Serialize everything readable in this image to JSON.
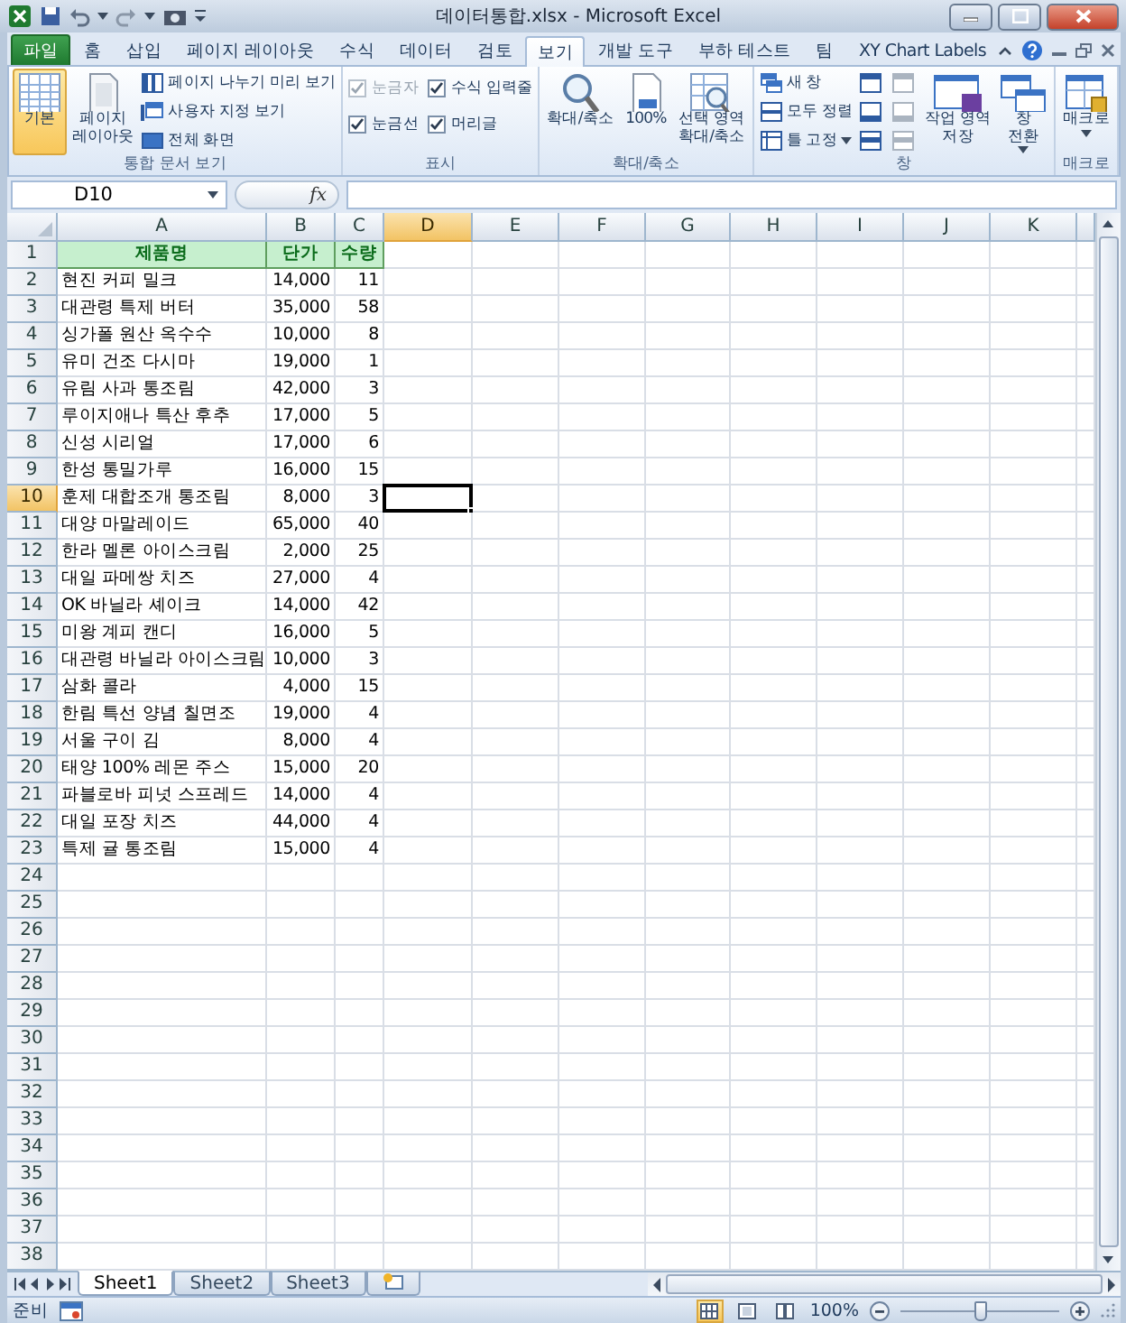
{
  "window": {
    "title": "데이터통합.xlsx - Microsoft Excel"
  },
  "ribbon_tabs": [
    {
      "label": "파일",
      "kind": "file",
      "selected": false
    },
    {
      "label": "홈",
      "kind": "tab",
      "selected": false
    },
    {
      "label": "삽입",
      "kind": "tab",
      "selected": false
    },
    {
      "label": "페이지 레이아웃",
      "kind": "tab",
      "selected": false
    },
    {
      "label": "수식",
      "kind": "tab",
      "selected": false
    },
    {
      "label": "데이터",
      "kind": "tab",
      "selected": false
    },
    {
      "label": "검토",
      "kind": "tab",
      "selected": false
    },
    {
      "label": "보기",
      "kind": "tab",
      "selected": true
    },
    {
      "label": "개발 도구",
      "kind": "tab",
      "selected": false
    },
    {
      "label": "부하 테스트",
      "kind": "tab",
      "selected": false
    },
    {
      "label": "팀",
      "kind": "tab",
      "selected": false
    },
    {
      "label": "XY Chart Labels",
      "kind": "tab",
      "selected": false
    }
  ],
  "ribbon_groups": [
    {
      "label": "통합 문서 보기",
      "controls": [
        {
          "kind": "large",
          "label": "기본",
          "selected": true
        },
        {
          "kind": "large",
          "label": "페이지\n레이아웃",
          "selected": false
        },
        {
          "kind": "stack",
          "items": [
            {
              "label": "페이지 나누기 미리 보기"
            },
            {
              "label": "사용자 지정 보기"
            },
            {
              "label": "전체 화면"
            }
          ]
        }
      ]
    },
    {
      "label": "표시",
      "controls": [
        {
          "kind": "checks",
          "items": [
            {
              "label": "눈금자",
              "checked": true,
              "disabled": true
            },
            {
              "label": "눈금선",
              "checked": true,
              "disabled": false
            },
            {
              "label": "수식 입력줄",
              "checked": true,
              "disabled": false
            },
            {
              "label": "머리글",
              "checked": true,
              "disabled": false
            }
          ]
        }
      ]
    },
    {
      "label": "확대/축소",
      "controls": [
        {
          "kind": "large",
          "label": "확대/축소"
        },
        {
          "kind": "large",
          "label": "100%"
        },
        {
          "kind": "large",
          "label": "선택 영역\n확대/축소"
        }
      ]
    },
    {
      "label": "창",
      "controls": [
        {
          "kind": "stack",
          "items": [
            {
              "label": "새 창"
            },
            {
              "label": "모두 정렬"
            },
            {
              "label": "틀 고정",
              "dropdown": true
            }
          ]
        },
        {
          "kind": "icons",
          "items": [
            {
              "disabled": false
            },
            {
              "disabled": false
            },
            {
              "disabled": false
            }
          ]
        },
        {
          "kind": "icons",
          "items": [
            {
              "disabled": true
            },
            {
              "disabled": true
            },
            {
              "disabled": true
            }
          ]
        },
        {
          "kind": "large",
          "label": "작업 영역\n저장"
        },
        {
          "kind": "large",
          "label": "창\n전환",
          "dropdown": true
        }
      ]
    },
    {
      "label": "매크로",
      "controls": [
        {
          "kind": "large",
          "label": "매크로",
          "dropdown": true
        }
      ]
    }
  ],
  "formula_bar": {
    "name_box": "D10",
    "function_label": "fx"
  },
  "sheet": {
    "columns": [
      {
        "label": "A",
        "selected": false
      },
      {
        "label": "B",
        "selected": false
      },
      {
        "label": "C",
        "selected": false
      },
      {
        "label": "D",
        "selected": true
      },
      {
        "label": "E",
        "selected": false
      },
      {
        "label": "F",
        "selected": false
      },
      {
        "label": "G",
        "selected": false
      },
      {
        "label": "H",
        "selected": false
      },
      {
        "label": "I",
        "selected": false
      },
      {
        "label": "J",
        "selected": false
      },
      {
        "label": "K",
        "selected": false
      }
    ],
    "rows": [
      {
        "number": "1",
        "kind": "header",
        "selected": false,
        "cells": [
          "제품명",
          "단가",
          "수량"
        ]
      },
      {
        "number": "2",
        "kind": "data",
        "selected": false,
        "cells": [
          "현진 커피 밀크",
          "14,000",
          "11"
        ]
      },
      {
        "number": "3",
        "kind": "data",
        "selected": false,
        "cells": [
          "대관령 특제 버터",
          "35,000",
          "58"
        ]
      },
      {
        "number": "4",
        "kind": "data",
        "selected": false,
        "cells": [
          "싱가폴 원산 옥수수",
          "10,000",
          "8"
        ]
      },
      {
        "number": "5",
        "kind": "data",
        "selected": false,
        "cells": [
          "유미 건조 다시마",
          "19,000",
          "1"
        ]
      },
      {
        "number": "6",
        "kind": "data",
        "selected": false,
        "cells": [
          "유림 사과 통조림",
          "42,000",
          "3"
        ]
      },
      {
        "number": "7",
        "kind": "data",
        "selected": false,
        "cells": [
          "루이지애나 특산 후추",
          "17,000",
          "5"
        ]
      },
      {
        "number": "8",
        "kind": "data",
        "selected": false,
        "cells": [
          "신성 시리얼",
          "17,000",
          "6"
        ]
      },
      {
        "number": "9",
        "kind": "data",
        "selected": false,
        "cells": [
          "한성 통밀가루",
          "16,000",
          "15"
        ]
      },
      {
        "number": "10",
        "kind": "data",
        "selected": true,
        "cells": [
          "훈제 대합조개 통조림",
          "8,000",
          "3"
        ]
      },
      {
        "number": "11",
        "kind": "data",
        "selected": false,
        "cells": [
          "대양 마말레이드",
          "65,000",
          "40"
        ]
      },
      {
        "number": "12",
        "kind": "data",
        "selected": false,
        "cells": [
          "한라 멜론 아이스크림",
          "2,000",
          "25"
        ]
      },
      {
        "number": "13",
        "kind": "data",
        "selected": false,
        "cells": [
          "대일 파메쌍 치즈",
          "27,000",
          "4"
        ]
      },
      {
        "number": "14",
        "kind": "data",
        "selected": false,
        "cells": [
          "OK 바닐라 셰이크",
          "14,000",
          "42"
        ]
      },
      {
        "number": "15",
        "kind": "data",
        "selected": false,
        "cells": [
          "미왕 계피 캔디",
          "16,000",
          "5"
        ]
      },
      {
        "number": "16",
        "kind": "data",
        "selected": false,
        "cells": [
          "대관령 바닐라 아이스크림",
          "10,000",
          "3"
        ]
      },
      {
        "number": "17",
        "kind": "data",
        "selected": false,
        "cells": [
          "삼화 콜라",
          "4,000",
          "15"
        ]
      },
      {
        "number": "18",
        "kind": "data",
        "selected": false,
        "cells": [
          "한림 특선 양념 칠면조",
          "19,000",
          "4"
        ]
      },
      {
        "number": "19",
        "kind": "data",
        "selected": false,
        "cells": [
          "서울 구이 김",
          "8,000",
          "4"
        ]
      },
      {
        "number": "20",
        "kind": "data",
        "selected": false,
        "cells": [
          "태양 100% 레몬 주스",
          "15,000",
          "20"
        ]
      },
      {
        "number": "21",
        "kind": "data",
        "selected": false,
        "cells": [
          "파블로바 피넛 스프레드",
          "14,000",
          "4"
        ]
      },
      {
        "number": "22",
        "kind": "data",
        "selected": false,
        "cells": [
          "대일 포장 치즈",
          "44,000",
          "4"
        ]
      },
      {
        "number": "23",
        "kind": "data",
        "selected": false,
        "cells": [
          "특제 귤 통조림",
          "15,000",
          "4"
        ]
      },
      {
        "number": "24",
        "kind": "empty",
        "selected": false
      },
      {
        "number": "25",
        "kind": "empty",
        "selected": false
      },
      {
        "number": "26",
        "kind": "empty",
        "selected": false
      },
      {
        "number": "27",
        "kind": "empty",
        "selected": false
      },
      {
        "number": "28",
        "kind": "empty",
        "selected": false
      },
      {
        "number": "29",
        "kind": "empty",
        "selected": false
      },
      {
        "number": "30",
        "kind": "empty",
        "selected": false
      },
      {
        "number": "31",
        "kind": "empty",
        "selected": false
      },
      {
        "number": "32",
        "kind": "empty",
        "selected": false
      },
      {
        "number": "33",
        "kind": "empty",
        "selected": false
      },
      {
        "number": "34",
        "kind": "empty",
        "selected": false
      },
      {
        "number": "35",
        "kind": "empty",
        "selected": false
      },
      {
        "number": "36",
        "kind": "empty",
        "selected": false
      },
      {
        "number": "37",
        "kind": "empty",
        "selected": false
      },
      {
        "number": "38",
        "kind": "empty",
        "selected": false
      }
    ]
  },
  "sheet_tabs": [
    {
      "label": "Sheet1",
      "selected": true
    },
    {
      "label": "Sheet2",
      "selected": false
    },
    {
      "label": "Sheet3",
      "selected": false
    }
  ],
  "status_bar": {
    "text": "준비",
    "views": [
      {
        "selected": true
      },
      {
        "selected": false
      },
      {
        "selected": false
      }
    ],
    "zoom": "100%",
    "zoom_slider": {
      "level": 0.5
    }
  }
}
